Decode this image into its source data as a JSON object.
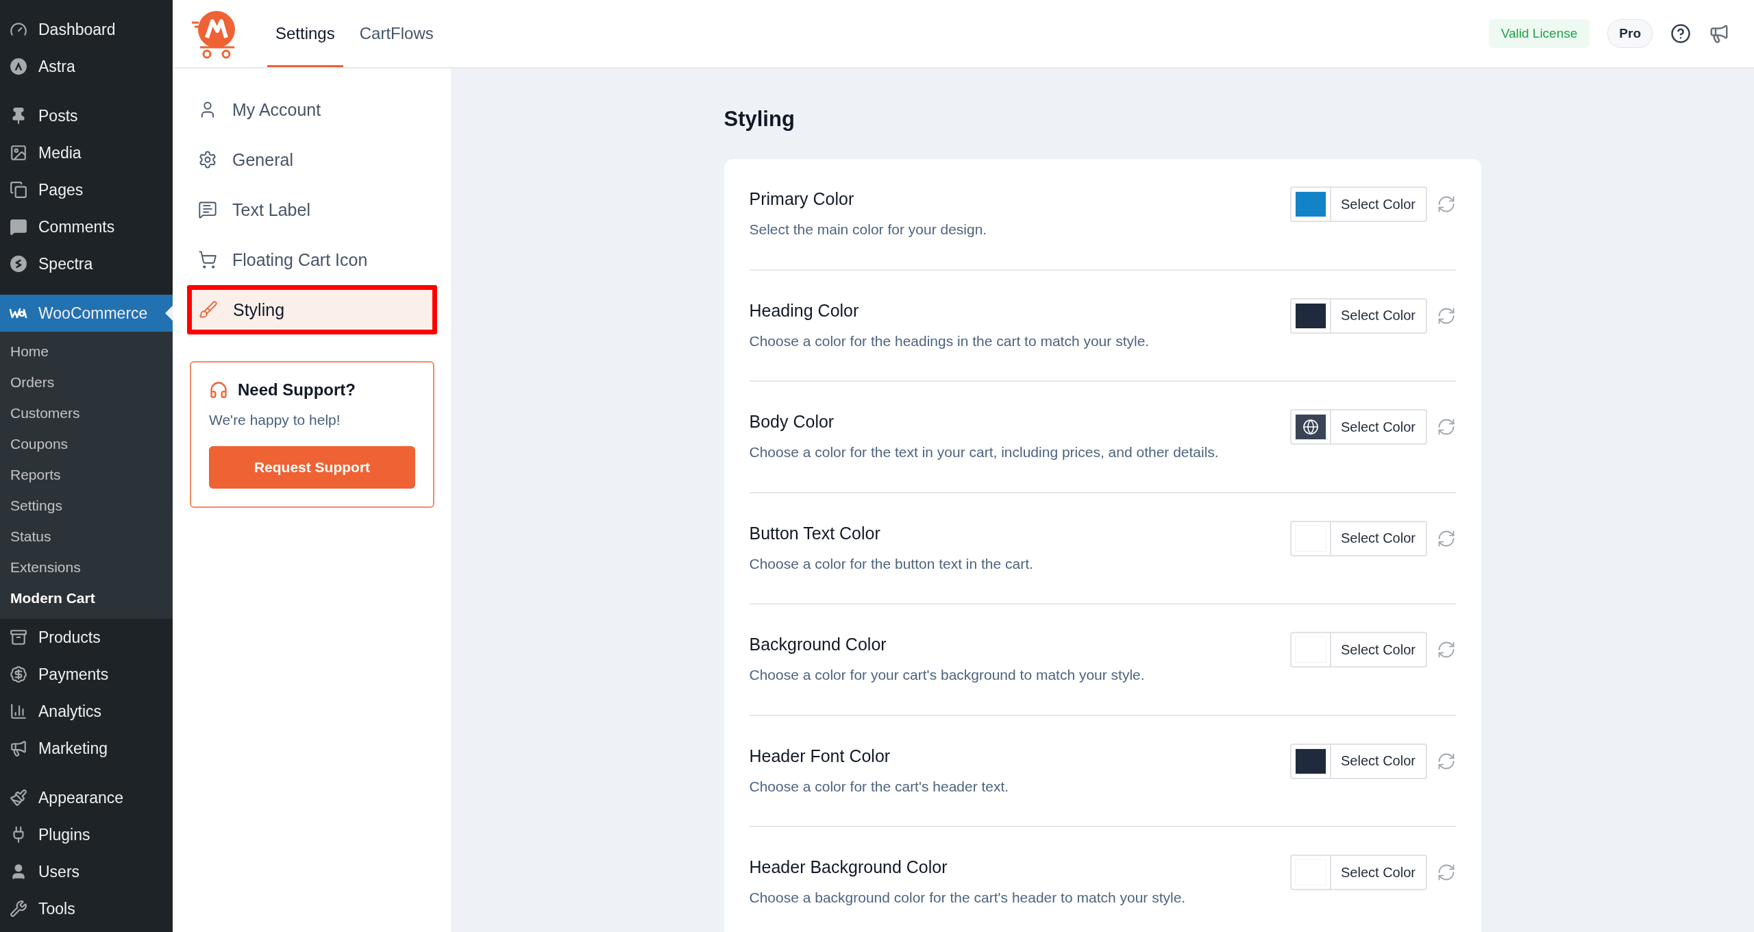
{
  "wp_sidebar": {
    "groups": [
      {
        "items": [
          {
            "label": "Dashboard",
            "selected": false
          },
          {
            "label": "Astra",
            "selected": false
          }
        ]
      },
      {
        "items": [
          {
            "label": "Posts",
            "selected": false
          },
          {
            "label": "Media",
            "selected": false
          },
          {
            "label": "Pages",
            "selected": false
          },
          {
            "label": "Comments",
            "selected": false
          },
          {
            "label": "Spectra",
            "selected": false
          }
        ]
      },
      {
        "items": [
          {
            "label": "WooCommerce",
            "selected": true,
            "children": [
              {
                "label": "Home",
                "selected": false
              },
              {
                "label": "Orders",
                "selected": false
              },
              {
                "label": "Customers",
                "selected": false
              },
              {
                "label": "Coupons",
                "selected": false
              },
              {
                "label": "Reports",
                "selected": false
              },
              {
                "label": "Settings",
                "selected": false
              },
              {
                "label": "Status",
                "selected": false
              },
              {
                "label": "Extensions",
                "selected": false
              },
              {
                "label": "Modern Cart",
                "selected": true
              }
            ]
          },
          {
            "label": "Products",
            "selected": false
          },
          {
            "label": "Payments",
            "selected": false
          },
          {
            "label": "Analytics",
            "selected": false
          },
          {
            "label": "Marketing",
            "selected": false
          }
        ]
      },
      {
        "items": [
          {
            "label": "Appearance",
            "selected": false
          },
          {
            "label": "Plugins",
            "selected": false
          },
          {
            "label": "Users",
            "selected": false
          },
          {
            "label": "Tools",
            "selected": false
          }
        ]
      }
    ]
  },
  "header": {
    "tabs": [
      {
        "label": "Settings",
        "selected": true
      },
      {
        "label": "CartFlows",
        "selected": false
      }
    ],
    "license_badge": "Valid License",
    "plan_badge": "Pro"
  },
  "settings_nav": {
    "items": [
      {
        "label": "My Account",
        "selected": false,
        "highlighted": false
      },
      {
        "label": "General",
        "selected": false,
        "highlighted": false
      },
      {
        "label": "Text Label",
        "selected": false,
        "highlighted": false
      },
      {
        "label": "Floating Cart Icon",
        "selected": false,
        "highlighted": false
      },
      {
        "label": "Styling",
        "selected": true,
        "highlighted": true
      }
    ],
    "support": {
      "title": "Need Support?",
      "text": "We're happy to help!",
      "button": "Request Support"
    }
  },
  "page": {
    "title": "Styling",
    "settings": [
      {
        "label": "Primary Color",
        "description": "Select the main color for your design.",
        "color": "#1283c7",
        "global": false,
        "button": "Select Color"
      },
      {
        "label": "Heading Color",
        "description": "Choose a color for the headings in the cart to match your style.",
        "color": "#1f2a3c",
        "global": false,
        "button": "Select Color"
      },
      {
        "label": "Body Color",
        "description": "Choose a color for the text in your cart, including prices, and other details.",
        "color": "#3a4456",
        "global": true,
        "button": "Select Color"
      },
      {
        "label": "Button Text Color",
        "description": "Choose a color for the button text in the cart.",
        "color": "#ffffff",
        "global": false,
        "button": "Select Color"
      },
      {
        "label": "Background Color",
        "description": "Choose a color for your cart's background to match your style.",
        "color": "#ffffff",
        "global": false,
        "button": "Select Color"
      },
      {
        "label": "Header Font Color",
        "description": "Choose a color for the cart's header text.",
        "color": "#1f2a3c",
        "global": false,
        "button": "Select Color"
      },
      {
        "label": "Header Background Color",
        "description": "Choose a background color for the cart's header to match your style.",
        "color": "#ffffff",
        "global": false,
        "button": "Select Color"
      }
    ]
  }
}
